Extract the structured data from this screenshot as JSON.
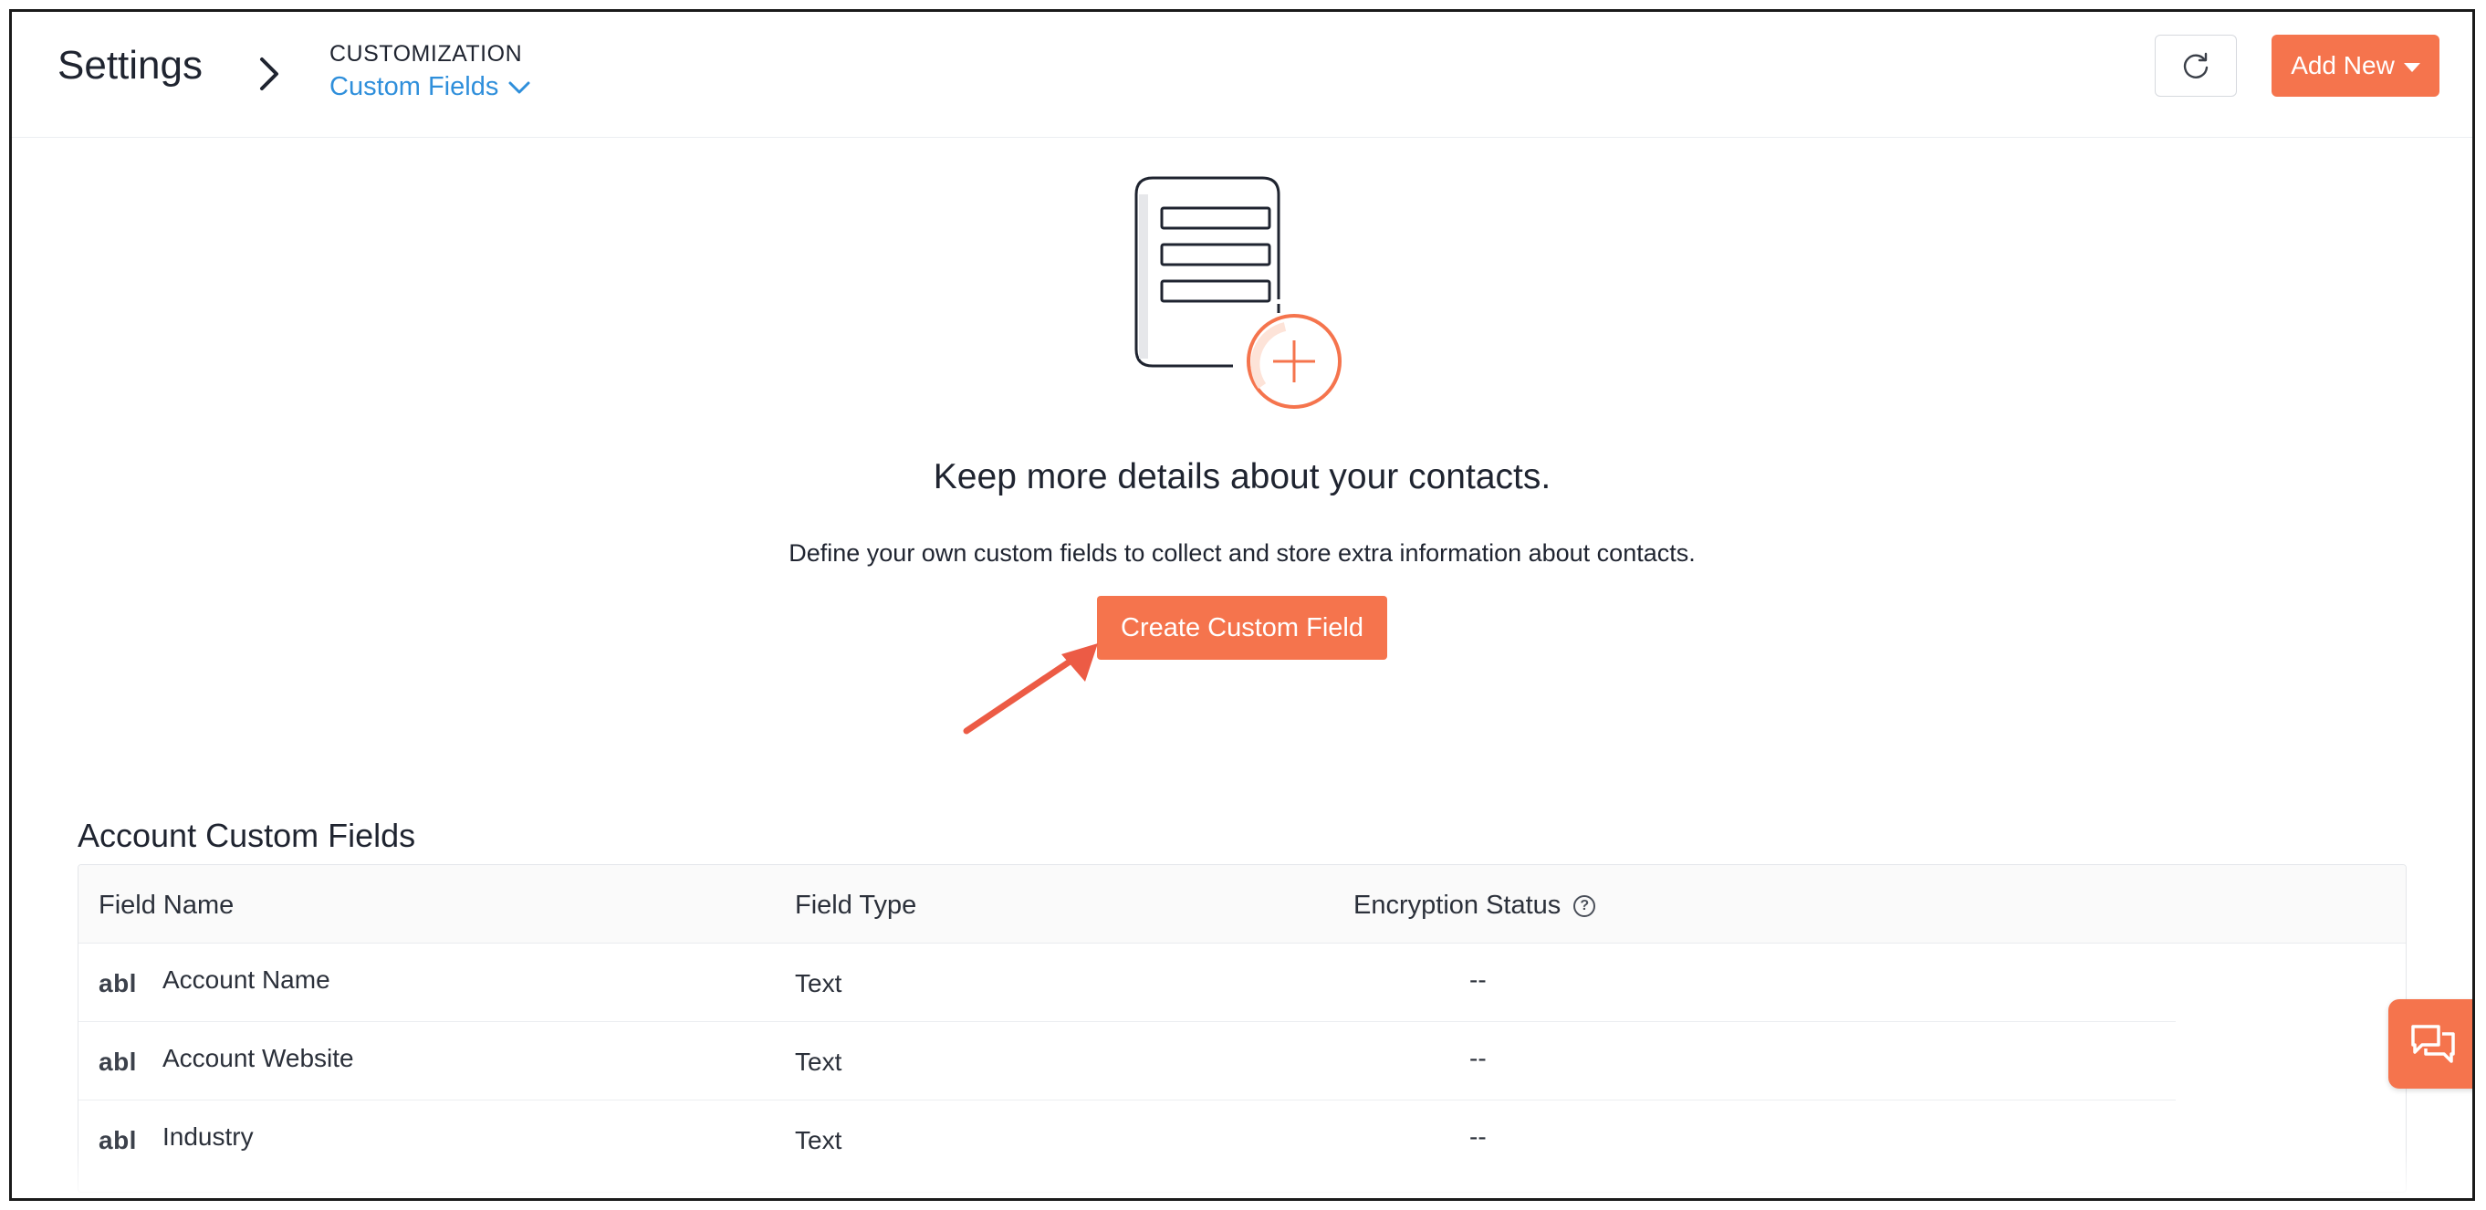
{
  "header": {
    "title": "Settings",
    "breadcrumb_parent": "CUSTOMIZATION",
    "breadcrumb_current": "Custom Fields",
    "add_new_label": "Add New"
  },
  "empty_state": {
    "title": "Keep more details about your contacts.",
    "description": "Define your own custom fields to collect and store extra information about contacts.",
    "create_button_label": "Create Custom Field"
  },
  "account_custom_fields": {
    "section_title": "Account Custom Fields",
    "columns": {
      "field_name": "Field Name",
      "field_type": "Field Type",
      "encryption_status": "Encryption Status"
    },
    "help_glyph": "?",
    "rows": [
      {
        "icon": "abl",
        "name": "Account Name",
        "type": "Text",
        "encryption": "--"
      },
      {
        "icon": "abl",
        "name": "Account Website",
        "type": "Text",
        "encryption": "--"
      },
      {
        "icon": "abl",
        "name": "Industry",
        "type": "Text",
        "encryption": "--"
      }
    ]
  },
  "theme": {
    "accent": "#f5744d",
    "link": "#2f8fdb",
    "text": "#1f2430"
  },
  "icons": {
    "breadcrumb_separator": "chevron-right-icon",
    "dropdown": "chevron-down-icon",
    "refresh": "refresh-icon",
    "add_new_caret": "caret-down-icon",
    "illustration": "document-add-illustration",
    "field_type": "text-field-icon",
    "help": "help-circle-icon",
    "chat": "chat-icon",
    "annotation": "arrow-annotation"
  }
}
